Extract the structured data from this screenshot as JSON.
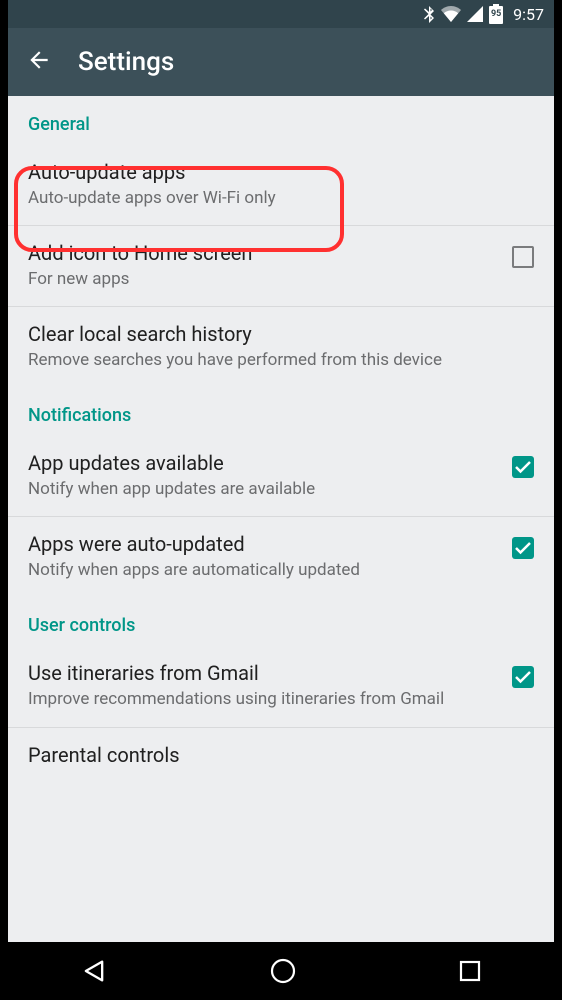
{
  "status": {
    "time": "9:57",
    "battery": "95"
  },
  "appbar": {
    "title": "Settings"
  },
  "sections": {
    "general": {
      "header": "General",
      "auto_update": {
        "title": "Auto-update apps",
        "sub": "Auto-update apps over Wi-Fi only"
      },
      "add_icon": {
        "title": "Add icon to Home screen",
        "sub": "For new apps"
      },
      "clear_hist": {
        "title": "Clear local search history",
        "sub": "Remove searches you have performed from this device"
      }
    },
    "notifications": {
      "header": "Notifications",
      "updates_avail": {
        "title": "App updates available",
        "sub": "Notify when app updates are available"
      },
      "auto_updated": {
        "title": "Apps were auto-updated",
        "sub": "Notify when apps are automatically updated"
      }
    },
    "user_controls": {
      "header": "User controls",
      "itineraries": {
        "title": "Use itineraries from Gmail",
        "sub": "Improve recommendations using itineraries from Gmail"
      },
      "parental": {
        "title": "Parental controls"
      }
    }
  }
}
